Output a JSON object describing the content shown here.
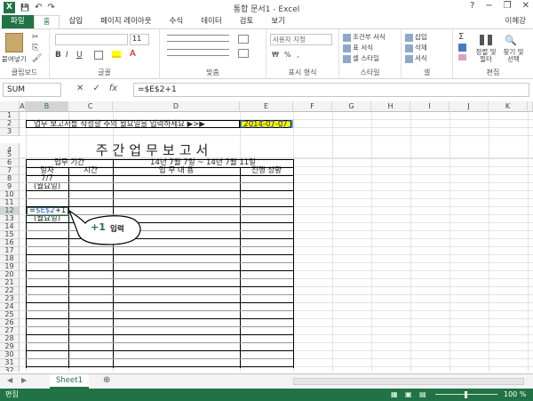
{
  "window": {
    "title": "통합 문서1 - Excel",
    "user": "이혜강",
    "min": "−",
    "restore": "❐",
    "close": "✕",
    "help": "?"
  },
  "qat": {
    "logo": "X",
    "save": "💾",
    "undo": "↶",
    "redo": "↷"
  },
  "tabs": [
    "파일",
    "홈",
    "삽입",
    "페이지 레이아웃",
    "수식",
    "데이터",
    "검토",
    "보기"
  ],
  "ribbon": {
    "clipboard": {
      "label": "클립보드",
      "paste": "붙여넣기"
    },
    "font": {
      "label": "글꼴",
      "size": "11"
    },
    "align": {
      "label": "맞춤"
    },
    "number": {
      "label": "표시 형식",
      "format": "사용자 지정"
    },
    "styles": {
      "label": "스타일",
      "cond": "조건부 서식",
      "table": "표 서식",
      "cell": "셀 스타일"
    },
    "cells": {
      "label": "셀",
      "insert": "삽입",
      "delete": "삭제",
      "format": "서식"
    },
    "edit": {
      "label": "편집",
      "sort": "정렬 및 필터",
      "find": "찾기 및 선택"
    }
  },
  "formula_bar": {
    "namebox": "SUM",
    "cancel": "✕",
    "enter": "✓",
    "fx": "fx",
    "content": "=$E$2+1"
  },
  "columns": [
    "A",
    "B",
    "C",
    "D",
    "E",
    "F",
    "G",
    "H",
    "I",
    "J",
    "K"
  ],
  "rows": [
    "1",
    "2",
    "3",
    "4",
    "5",
    "6",
    "7",
    "8",
    "9",
    "10",
    "11",
    "12",
    "13",
    "14",
    "15",
    "16",
    "17",
    "18",
    "19",
    "20",
    "21",
    "22",
    "23",
    "24",
    "25",
    "26",
    "27",
    "28",
    "29",
    "30",
    "31",
    "32",
    "33",
    "34"
  ],
  "sheet": {
    "instruction": "업무 보고서를 작성할 주의 월요일을 입력하세요 ▶>▶",
    "date": "2014-07-07",
    "heading": "주간업무보고서",
    "period_label": "업무 기간",
    "period_value": "14년 7월 7일 ~ 14년 7월 11일",
    "hdr_date": "일자",
    "hdr_time": "시간",
    "hdr_content": "업 무 내 용",
    "hdr_status": "진행 상황",
    "b8": "7/7",
    "b9": "(월요일)",
    "b12_prefix": "=",
    "b12_ref": "$E$2",
    "b12_suffix": "+1",
    "b13": "(월요일)"
  },
  "annotation": {
    "plus": "+1",
    "text": "입력"
  },
  "sheet_tabs": {
    "active": "Sheet1",
    "add": "⊕"
  },
  "status": {
    "mode": "편집",
    "zoom": "100 %"
  },
  "colors": {
    "accent": "#217346",
    "date_fill": "#ffff00",
    "ref_blue": "#2a5bd7"
  }
}
